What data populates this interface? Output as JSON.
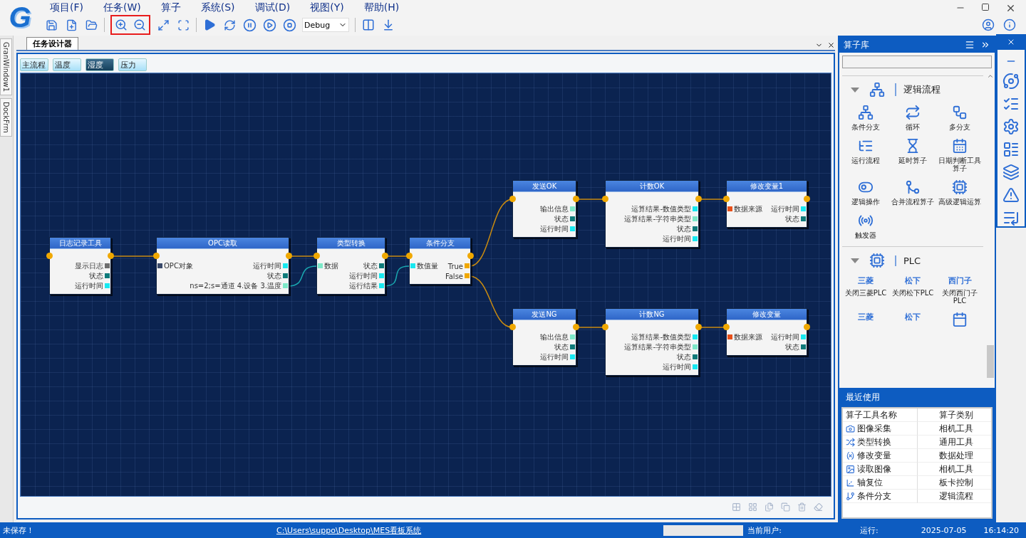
{
  "app": {
    "logo": "G"
  },
  "menu": [
    "项目(F)",
    "任务(W)",
    "算子",
    "系统(S)",
    "调试(D)",
    "视图(Y)",
    "帮助(H)"
  ],
  "toolbar": {
    "mode": "Debug",
    "highlighted_group": true
  },
  "side_tabs": [
    "GranWindow1",
    "DockFrm"
  ],
  "document_tab": {
    "title": "任务设计器"
  },
  "flow_tabs": [
    {
      "label": "主流程",
      "selected": false
    },
    {
      "label": "温度",
      "selected": false
    },
    {
      "label": "湿度",
      "selected": true
    },
    {
      "label": "压力",
      "selected": false
    }
  ],
  "nodes": [
    {
      "title": "日志记录工具",
      "rows": [
        {
          "right": {
            "label": "显示日志",
            "color": "#6e6e6e"
          }
        },
        {
          "right": {
            "label": "状态",
            "color": "#0e7a7a"
          }
        },
        {
          "right": {
            "label": "运行时间",
            "color": "#18e8f0"
          }
        }
      ]
    },
    {
      "title": "OPC读取",
      "rows": [
        {
          "left": {
            "label": "OPC对象",
            "color": "#3a4a6a"
          },
          "right": {
            "label": "运行时间",
            "color": "#18e8f0"
          }
        },
        {
          "right": {
            "label": "状态",
            "color": "#0e7a7a"
          }
        },
        {
          "right": {
            "label": "ns=2;s=通道 4.设备 3.温度",
            "color": "#7de8c8"
          }
        }
      ]
    },
    {
      "title": "类型转换",
      "rows": [
        {
          "left": {
            "label": "数据",
            "color": "#7de8c8"
          },
          "right": {
            "label": "状态",
            "color": "#0e7a7a"
          }
        },
        {
          "right": {
            "label": "运行时间",
            "color": "#18e8f0"
          }
        },
        {
          "right": {
            "label": "运行结果",
            "color": "#18e8f0"
          }
        }
      ]
    },
    {
      "title": "条件分支",
      "rows": [
        {
          "left": {
            "label": "数值量",
            "color": "#18e8f0"
          },
          "right": {
            "label": "True",
            "color": "#f0a800"
          }
        },
        {
          "right": {
            "label": "False",
            "color": "#f0a800"
          }
        }
      ]
    },
    {
      "title": "发送OK",
      "rows": [
        {
          "right": {
            "label": "输出信息",
            "color": "#7de8c8"
          }
        },
        {
          "right": {
            "label": "状态",
            "color": "#0e7a7a"
          }
        },
        {
          "right": {
            "label": "运行时间",
            "color": "#18e8f0"
          }
        }
      ]
    },
    {
      "title": "计数OK",
      "rows": [
        {
          "right": {
            "label": "运算结果-数值类型",
            "color": "#18e8f0"
          }
        },
        {
          "right": {
            "label": "运算结果-字符串类型",
            "color": "#7de8c8"
          }
        },
        {
          "right": {
            "label": "状态",
            "color": "#0e7a7a"
          }
        },
        {
          "right": {
            "label": "运行时间",
            "color": "#18e8f0"
          }
        }
      ]
    },
    {
      "title": "修改变量1",
      "rows": [
        {
          "left": {
            "label": "数据来源",
            "color": "#e8501a"
          },
          "right": {
            "label": "运行时间",
            "color": "#18e8f0"
          }
        },
        {
          "right": {
            "label": "状态",
            "color": "#0e7a7a"
          }
        }
      ]
    },
    {
      "title": "发送NG",
      "rows": [
        {
          "right": {
            "label": "输出信息",
            "color": "#7de8c8"
          }
        },
        {
          "right": {
            "label": "状态",
            "color": "#0e7a7a"
          }
        },
        {
          "right": {
            "label": "运行时间",
            "color": "#18e8f0"
          }
        }
      ]
    },
    {
      "title": "计数NG",
      "rows": [
        {
          "right": {
            "label": "运算结果-数值类型",
            "color": "#18e8f0"
          }
        },
        {
          "right": {
            "label": "运算结果-字符串类型",
            "color": "#7de8c8"
          }
        },
        {
          "right": {
            "label": "状态",
            "color": "#0e7a7a"
          }
        },
        {
          "right": {
            "label": "运行时间",
            "color": "#18e8f0"
          }
        }
      ]
    },
    {
      "title": "修改变量",
      "rows": [
        {
          "left": {
            "label": "数据来源",
            "color": "#e8501a"
          },
          "right": {
            "label": "运行时间",
            "color": "#18e8f0"
          }
        },
        {
          "right": {
            "label": "状态",
            "color": "#0e7a7a"
          }
        }
      ]
    }
  ],
  "library": {
    "title": "算子库",
    "sections": [
      {
        "title": "逻辑流程",
        "expanded": true,
        "items": [
          {
            "kind": "icon",
            "label": "条件分支"
          },
          {
            "kind": "icon",
            "label": "循环"
          },
          {
            "kind": "icon",
            "label": "多分支"
          },
          {
            "kind": "icon",
            "label": "运行流程"
          },
          {
            "kind": "icon",
            "label": "延时算子"
          },
          {
            "kind": "icon",
            "label": "日期判断工具算子"
          },
          {
            "kind": "icon",
            "label": "逻辑操作"
          },
          {
            "kind": "icon",
            "label": "合并流程算子"
          },
          {
            "kind": "icon",
            "label": "高级逻辑运算"
          },
          {
            "kind": "icon",
            "label": "触发器"
          }
        ]
      },
      {
        "title": "PLC",
        "expanded": true,
        "items": [
          {
            "kind": "text",
            "icon_text": "三菱",
            "label": "关闭三菱PLC"
          },
          {
            "kind": "text",
            "icon_text": "松下",
            "label": "关闭松下PLC"
          },
          {
            "kind": "text",
            "icon_text": "西门子",
            "label": "关闭西门子PLC"
          },
          {
            "kind": "text",
            "icon_text": "三菱"
          },
          {
            "kind": "text",
            "icon_text": "松下"
          },
          {
            "kind": "icon"
          }
        ]
      }
    ]
  },
  "recent": {
    "title": "最近使用",
    "columns": [
      "算子工具名称",
      "算子类别"
    ],
    "rows": [
      [
        "图像采集",
        "相机工具"
      ],
      [
        "类型转换",
        "通用工具"
      ],
      [
        "修改变量",
        "数据处理"
      ],
      [
        "读取图像",
        "相机工具"
      ],
      [
        "轴复位",
        "板卡控制"
      ],
      [
        "条件分支",
        "逻辑流程"
      ]
    ]
  },
  "status_bar": {
    "save_state": "未保存！",
    "path": "C:\\Users\\suppo\\Desktop\\MES看板系统",
    "user_label": "当前用户:",
    "run_label": "运行:",
    "date": "2025-07-05",
    "time": "16:14:20"
  }
}
